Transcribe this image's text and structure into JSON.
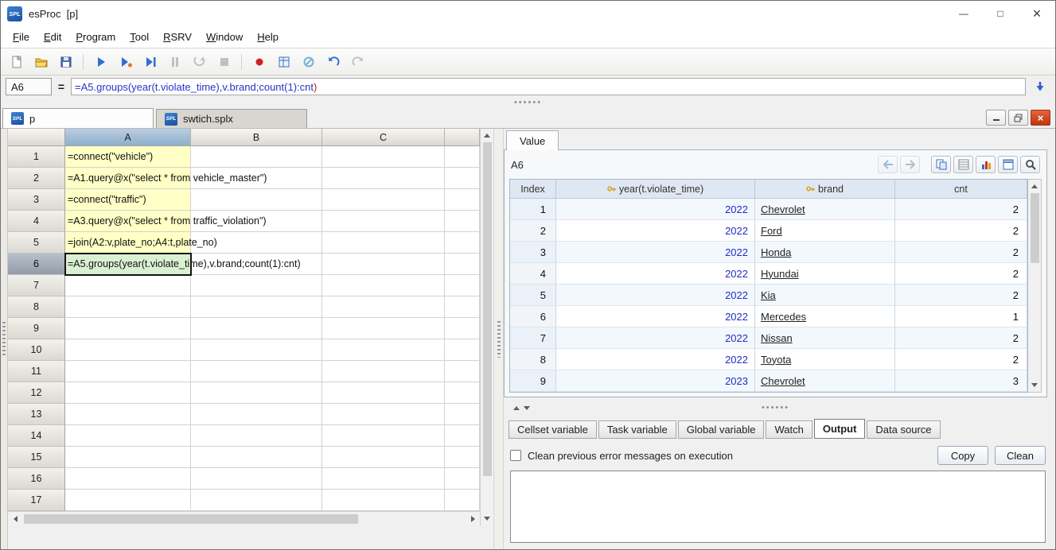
{
  "colors": {
    "executed_cell": "#ffffc6",
    "selected_cell": "#daf0d2",
    "year_link": "#1f2dc2"
  },
  "window": {
    "logo": "SPL",
    "title": "esProc  [p]",
    "controls": {
      "minimize": "—",
      "maximize": "□",
      "close": "×"
    }
  },
  "menu": {
    "items": [
      "File",
      "Edit",
      "Program",
      "Tool",
      "RSRV",
      "Window",
      "Help"
    ]
  },
  "toolbar": {
    "icons": [
      "new-file",
      "open-file",
      "save",
      "execute",
      "execute-to-cursor",
      "step-execute",
      "pause",
      "continue",
      "stop-execution",
      "record",
      "calculate-area",
      "clear-cells",
      "undo",
      "redo"
    ]
  },
  "formula_bar": {
    "cell_ref": "A6",
    "equals": "=",
    "formula_main": "=A5.groups(year(t.violate_time),v.brand;count(1):cnt",
    "formula_tail": ")"
  },
  "sheet_tabs": [
    {
      "label": "p",
      "active": true
    },
    {
      "label": "swtich.splx",
      "active": false
    }
  ],
  "grid": {
    "columns": [
      "A",
      "B",
      "C"
    ],
    "selected_cell": "A6",
    "rows": [
      {
        "n": "1",
        "a": "=connect(\"vehicle\")",
        "state": "done"
      },
      {
        "n": "2",
        "a": "=A1.query@x(\"select * from vehicle_master\")",
        "state": "done"
      },
      {
        "n": "3",
        "a": "=connect(\"traffic\")",
        "state": "done"
      },
      {
        "n": "4",
        "a": "=A3.query@x(\"select * from traffic_violation\")",
        "state": "done"
      },
      {
        "n": "5",
        "a": "=join(A2:v,plate_no;A4:t,plate_no)",
        "state": "done"
      },
      {
        "n": "6",
        "a": "=A5.groups(year(t.violate_time),v.brand;count(1):cnt)",
        "state": "selected"
      },
      {
        "n": "7",
        "a": "",
        "state": ""
      },
      {
        "n": "8",
        "a": "",
        "state": ""
      },
      {
        "n": "9",
        "a": "",
        "state": ""
      },
      {
        "n": "10",
        "a": "",
        "state": ""
      },
      {
        "n": "11",
        "a": "",
        "state": ""
      },
      {
        "n": "12",
        "a": "",
        "state": ""
      },
      {
        "n": "13",
        "a": "",
        "state": ""
      },
      {
        "n": "14",
        "a": "",
        "state": ""
      },
      {
        "n": "15",
        "a": "",
        "state": ""
      },
      {
        "n": "16",
        "a": "",
        "state": ""
      },
      {
        "n": "17",
        "a": "",
        "state": ""
      }
    ]
  },
  "value_panel": {
    "tab_label": "Value",
    "cell_label": "A6",
    "toolbar_icons": [
      "back",
      "forward",
      "copy-data",
      "list-view",
      "chart",
      "edit-form",
      "search"
    ],
    "table": {
      "headers": [
        {
          "label": "Index",
          "key": false
        },
        {
          "label": "year(t.violate_time)",
          "key": true
        },
        {
          "label": "brand",
          "key": true
        },
        {
          "label": "cnt",
          "key": false
        }
      ],
      "rows": [
        {
          "index": "1",
          "year": "2022",
          "brand": "Chevrolet",
          "cnt": "2"
        },
        {
          "index": "2",
          "year": "2022",
          "brand": "Ford",
          "cnt": "2"
        },
        {
          "index": "3",
          "year": "2022",
          "brand": "Honda",
          "cnt": "2"
        },
        {
          "index": "4",
          "year": "2022",
          "brand": "Hyundai",
          "cnt": "2"
        },
        {
          "index": "5",
          "year": "2022",
          "brand": "Kia",
          "cnt": "2"
        },
        {
          "index": "6",
          "year": "2022",
          "brand": "Mercedes",
          "cnt": "1"
        },
        {
          "index": "7",
          "year": "2022",
          "brand": "Nissan",
          "cnt": "2"
        },
        {
          "index": "8",
          "year": "2022",
          "brand": "Toyota",
          "cnt": "2"
        },
        {
          "index": "9",
          "year": "2023",
          "brand": "Chevrolet",
          "cnt": "3"
        }
      ]
    }
  },
  "bottom_tabs": [
    {
      "label": "Cellset variable",
      "active": false
    },
    {
      "label": "Task variable",
      "active": false
    },
    {
      "label": "Global variable",
      "active": false
    },
    {
      "label": "Watch",
      "active": false
    },
    {
      "label": "Output",
      "active": true
    },
    {
      "label": "Data source",
      "active": false
    }
  ],
  "output_panel": {
    "checkbox_label": "Clean previous error messages on execution",
    "checkbox_checked": false,
    "copy_label": "Copy",
    "clean_label": "Clean",
    "console_text": ""
  }
}
